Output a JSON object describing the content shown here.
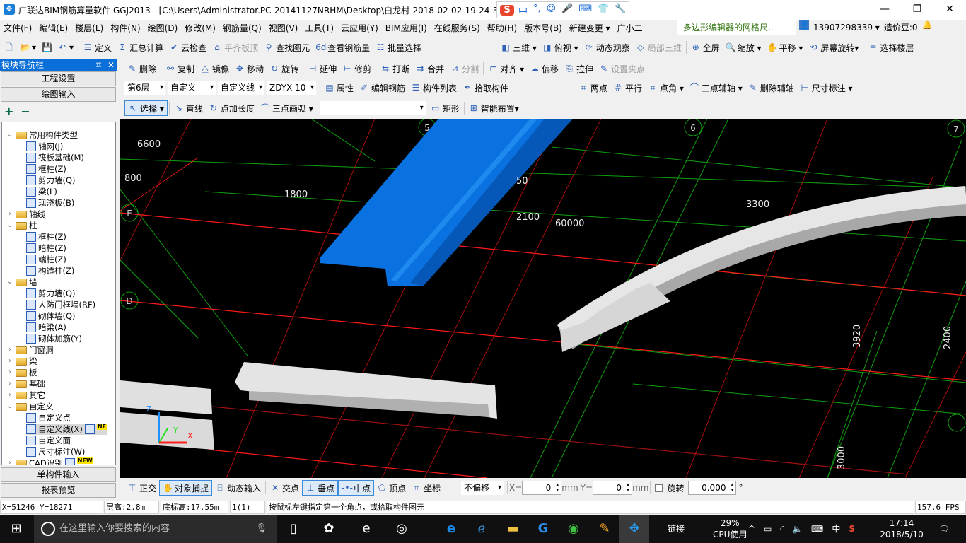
{
  "window": {
    "title": "广联达BIM钢筋算量软件 GGJ2013 - [C:\\Users\\Administrator.PC-20141127NRHM\\Desktop\\白龙村-2018-02-02-19-24-35",
    "min": "—",
    "max": "❐",
    "close": "✕"
  },
  "ime": {
    "logo": "S",
    "items": [
      "中",
      "°,",
      "☺",
      "🎤",
      "⌨",
      "👕",
      "🔧"
    ]
  },
  "menu": [
    "文件(F)",
    "编辑(E)",
    "楼层(L)",
    "构件(N)",
    "绘图(D)",
    "修改(M)",
    "钢筋量(Q)",
    "视图(V)",
    "工具(T)",
    "云应用(Y)",
    "BIM应用(I)",
    "在线服务(S)",
    "帮助(H)",
    "版本号(B)",
    "新建变更 ▾",
    "广小二"
  ],
  "menu_right": {
    "news": "多边形编辑器的网格尺..",
    "user": "13907298339 ▾",
    "beans": "造价豆:0"
  },
  "toolbar1": [
    {
      "l": "",
      "i": "new-icon",
      "g": "🗋"
    },
    {
      "l": "▾",
      "i": "open-icon",
      "g": "📂"
    },
    {
      "l": "",
      "i": "save-icon",
      "g": "💾"
    },
    {
      "l": "▾",
      "i": "undo-icon",
      "g": "↶"
    },
    {
      "l": "定义",
      "i": "define-icon",
      "g": "☰"
    },
    {
      "l": "汇总计算",
      "i": "sigma-icon",
      "g": "Σ"
    },
    {
      "l": "云检查",
      "i": "cloud-check-icon",
      "g": "✔"
    },
    {
      "l": "平齐板顶",
      "i": "align-top-icon",
      "g": "⌂",
      "d": true
    },
    {
      "l": "查找图元",
      "i": "binoculars-icon",
      "g": "⚲"
    },
    {
      "l": "查看钢筋量",
      "i": "rebar-view-icon",
      "g": "6d"
    },
    {
      "l": "批量选择",
      "i": "batch-select-icon",
      "g": "☷"
    }
  ],
  "toolbar1b": [
    {
      "l": "三维 ▾",
      "i": "3d-icon",
      "g": "◧"
    },
    {
      "l": "俯视 ▾",
      "i": "top-view-icon",
      "g": "◨"
    },
    {
      "l": "动态观察",
      "i": "orbit-icon",
      "g": "⟳"
    },
    {
      "l": "局部三维",
      "i": "local-3d-icon",
      "g": "◇",
      "d": true
    },
    {
      "l": "全屏",
      "i": "fullscreen-icon",
      "g": "⊕"
    },
    {
      "l": "缩放 ▾",
      "i": "zoom-icon",
      "g": "🔍"
    },
    {
      "l": "平移 ▾",
      "i": "pan-icon",
      "g": "✋"
    },
    {
      "l": "屏幕旋转▾",
      "i": "screen-rotate-icon",
      "g": "⟲"
    },
    {
      "l": "选择楼层",
      "i": "select-floor-icon",
      "g": "≡"
    }
  ],
  "toolbar2": [
    {
      "l": "删除",
      "i": "delete-icon",
      "g": "✎"
    },
    {
      "l": "复制",
      "i": "copy-icon",
      "g": "⚯"
    },
    {
      "l": "镜像",
      "i": "mirror-icon",
      "g": "⧋"
    },
    {
      "l": "移动",
      "i": "move-icon",
      "g": "✥"
    },
    {
      "l": "旋转",
      "i": "rotate-icon",
      "g": "↻"
    },
    {
      "l": "延伸",
      "i": "extend-icon",
      "g": "⊣"
    },
    {
      "l": "修剪",
      "i": "trim-icon",
      "g": "⊢"
    },
    {
      "l": "打断",
      "i": "break-icon",
      "g": "⇆"
    },
    {
      "l": "合并",
      "i": "merge-icon",
      "g": "⇉"
    },
    {
      "l": "分割",
      "i": "split-icon",
      "g": "⊿",
      "d": true
    },
    {
      "l": "对齐 ▾",
      "i": "align-icon",
      "g": "⊏"
    },
    {
      "l": "偏移",
      "i": "offset-icon",
      "g": "☁"
    },
    {
      "l": "拉伸",
      "i": "stretch-icon",
      "g": "⎘"
    },
    {
      "l": "设置夹点",
      "i": "grip-icon",
      "g": "✎",
      "d": true
    }
  ],
  "selectors": {
    "floor": "第6层",
    "type": "自定义",
    "sub": "自定义线",
    "name": "ZDYX-10"
  },
  "toolbar3": [
    {
      "l": "属性",
      "i": "properties-icon",
      "g": "▤"
    },
    {
      "l": "编辑钢筋",
      "i": "edit-rebar-icon",
      "g": "✐"
    },
    {
      "l": "构件列表",
      "i": "component-list-icon",
      "g": "☰"
    },
    {
      "l": "拾取构件",
      "i": "pick-icon",
      "g": "✒"
    }
  ],
  "toolbar3b": [
    {
      "l": "两点",
      "i": "two-point-axis-icon",
      "g": "⌗"
    },
    {
      "l": "平行",
      "i": "parallel-axis-icon",
      "g": "#"
    },
    {
      "l": "点角 ▾",
      "i": "point-angle-icon",
      "g": "⌗"
    },
    {
      "l": "三点辅轴 ▾",
      "i": "three-point-axis-icon",
      "g": "⌒"
    },
    {
      "l": "删除辅轴",
      "i": "delete-axis-icon",
      "g": "✎"
    },
    {
      "l": "尺寸标注 ▾",
      "i": "dimension-icon",
      "g": "⊢"
    }
  ],
  "toolbar4": [
    {
      "l": "选择 ▾",
      "i": "select-icon",
      "g": "↖",
      "on": true
    },
    {
      "l": "直线",
      "i": "line-icon",
      "g": "↘"
    },
    {
      "l": "点加长度",
      "i": "point-length-icon",
      "g": "↻"
    },
    {
      "l": "三点画弧 ▾",
      "i": "arc-icon",
      "g": "⌒"
    },
    {
      "l": "",
      "i": "blank-dropdown",
      "g": "",
      "dd": true
    },
    {
      "l": "矩形",
      "i": "rectangle-icon",
      "g": "▭"
    },
    {
      "l": "智能布置▾",
      "i": "smart-layout-icon",
      "g": "⊞"
    }
  ],
  "sidebar": {
    "title": "模块导航栏",
    "pin": "ㅍ",
    "close": "✕",
    "project_settings": "工程设置",
    "drawing_input": "绘图输入",
    "expand": "+",
    "collapse": "−",
    "single_input": "单构件输入",
    "report": "报表预览",
    "tree": [
      {
        "l": "常用构件类型",
        "lv": 0,
        "f": true,
        "o": true
      },
      {
        "l": "轴网(J)",
        "lv": 1
      },
      {
        "l": "筏板基础(M)",
        "lv": 1
      },
      {
        "l": "框柱(Z)",
        "lv": 1
      },
      {
        "l": "剪力墙(Q)",
        "lv": 1
      },
      {
        "l": "梁(L)",
        "lv": 1
      },
      {
        "l": "现浇板(B)",
        "lv": 1
      },
      {
        "l": "轴线",
        "lv": 0,
        "f": true
      },
      {
        "l": "柱",
        "lv": 0,
        "f": true,
        "o": true
      },
      {
        "l": "框柱(Z)",
        "lv": 1
      },
      {
        "l": "暗柱(Z)",
        "lv": 1
      },
      {
        "l": "端柱(Z)",
        "lv": 1
      },
      {
        "l": "构造柱(Z)",
        "lv": 1
      },
      {
        "l": "墙",
        "lv": 0,
        "f": true,
        "o": true
      },
      {
        "l": "剪力墙(Q)",
        "lv": 1
      },
      {
        "l": "人防门框墙(RF)",
        "lv": 1
      },
      {
        "l": "砌体墙(Q)",
        "lv": 1
      },
      {
        "l": "暗梁(A)",
        "lv": 1
      },
      {
        "l": "砌体加筋(Y)",
        "lv": 1
      },
      {
        "l": "门窗洞",
        "lv": 0,
        "f": true
      },
      {
        "l": "梁",
        "lv": 0,
        "f": true
      },
      {
        "l": "板",
        "lv": 0,
        "f": true
      },
      {
        "l": "基础",
        "lv": 0,
        "f": true
      },
      {
        "l": "其它",
        "lv": 0,
        "f": true
      },
      {
        "l": "自定义",
        "lv": 0,
        "f": true,
        "o": true
      },
      {
        "l": "自定义点",
        "lv": 1
      },
      {
        "l": "自定义线(X)",
        "lv": 1,
        "sel": true,
        "new": "NE"
      },
      {
        "l": "自定义面",
        "lv": 1
      },
      {
        "l": "尺寸标注(W)",
        "lv": 1
      },
      {
        "l": "CAD识别",
        "lv": 0,
        "f": true,
        "new": "NEW"
      }
    ]
  },
  "viewport": {
    "dims": [
      "6600",
      "800",
      "1800",
      "2100",
      "60000",
      "3300",
      "2400",
      "3920",
      "3000",
      "50"
    ],
    "axes": [
      "5",
      "6",
      "7",
      "E",
      "D"
    ],
    "triad": [
      "Z",
      "Y",
      "X"
    ],
    "colors": {
      "beam_selected": "#0a72e0",
      "grid_red": "#ff1a1a",
      "grid_green": "#10a010",
      "background": "#000000"
    }
  },
  "bottombar": {
    "items": [
      {
        "l": "正交",
        "i": "ortho-icon",
        "g": "⊤"
      },
      {
        "l": "对象捕捉",
        "i": "snap-icon",
        "g": "✋",
        "on": true
      },
      {
        "l": "动态输入",
        "i": "dynamic-input-icon",
        "g": "⌸"
      },
      {
        "l": "交点",
        "i": "intersection-icon",
        "g": "✕"
      },
      {
        "l": "垂点",
        "i": "perpendicular-icon",
        "g": "⊥",
        "on": true
      },
      {
        "l": "中点",
        "i": "midpoint-icon",
        "g": "-•-",
        "on": true
      },
      {
        "l": "顶点",
        "i": "vertex-icon",
        "g": "⬠"
      },
      {
        "l": "坐标",
        "i": "coordinate-icon",
        "g": "⌗"
      }
    ],
    "offset": "不偏移",
    "x_label": "X=",
    "x": "0",
    "unit": "mm",
    "y_label": "Y=",
    "y": "0",
    "rotate_label": "旋转",
    "rotate": "0.000",
    "deg": "°"
  },
  "status": {
    "coords": "X=51246 Y=18271",
    "floor_height": "层高:2.8m",
    "base_elev": "底标高:17.55m",
    "count": "1(1)",
    "hint": "按鼠标左键指定第一个角点，或拾取构件图元",
    "fps": "157.6 FPS"
  },
  "taskbar": {
    "search": "在这里输入你要搜索的内容",
    "link": "链接",
    "cpu": "29%",
    "cpu_label": "CPU使用",
    "ime": "中",
    "time": "17:14",
    "date": "2018/5/10"
  }
}
